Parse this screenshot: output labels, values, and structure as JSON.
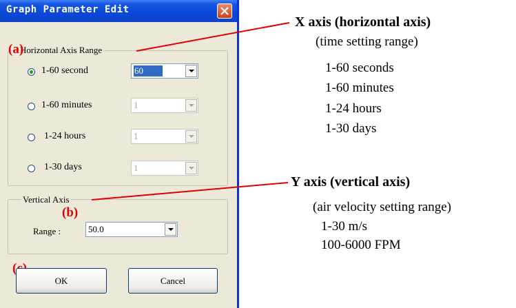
{
  "dialog": {
    "title": "Graph Parameter Edit",
    "horizontal_group": {
      "legend": "Horizontal Axis Range",
      "options": [
        {
          "label": "1-60 second",
          "checked": true,
          "combo_value": "60",
          "enabled": true
        },
        {
          "label": "1-60 minutes",
          "checked": false,
          "combo_value": "1",
          "enabled": false
        },
        {
          "label": "1-24 hours",
          "checked": false,
          "combo_value": "1",
          "enabled": false
        },
        {
          "label": "1-30 days",
          "checked": false,
          "combo_value": "1",
          "enabled": false
        }
      ]
    },
    "vertical_group": {
      "legend": "Vertical Axis",
      "range_label": "Range :",
      "range_value": "50.0"
    },
    "buttons": {
      "ok": "OK",
      "cancel": "Cancel"
    },
    "markers": {
      "a": "(a)",
      "b": "(b)",
      "c": "(c)"
    }
  },
  "annotations": {
    "x_axis": {
      "heading": "X axis (horizontal axis)",
      "lines": [
        "(time setting range)",
        "1-60 seconds",
        "1-60 minutes",
        "1-24 hours",
        "1-30 days"
      ]
    },
    "y_axis": {
      "heading": "Y axis (vertical axis)",
      "lines": [
        "(air velocity setting range)",
        "1-30 m/s",
        "100-6000 FPM"
      ]
    }
  },
  "colors": {
    "title_bar": "#0a48d8",
    "dialog_bg": "#ece9d8",
    "annotation_red": "#e00000",
    "selection": "#316ac5"
  }
}
